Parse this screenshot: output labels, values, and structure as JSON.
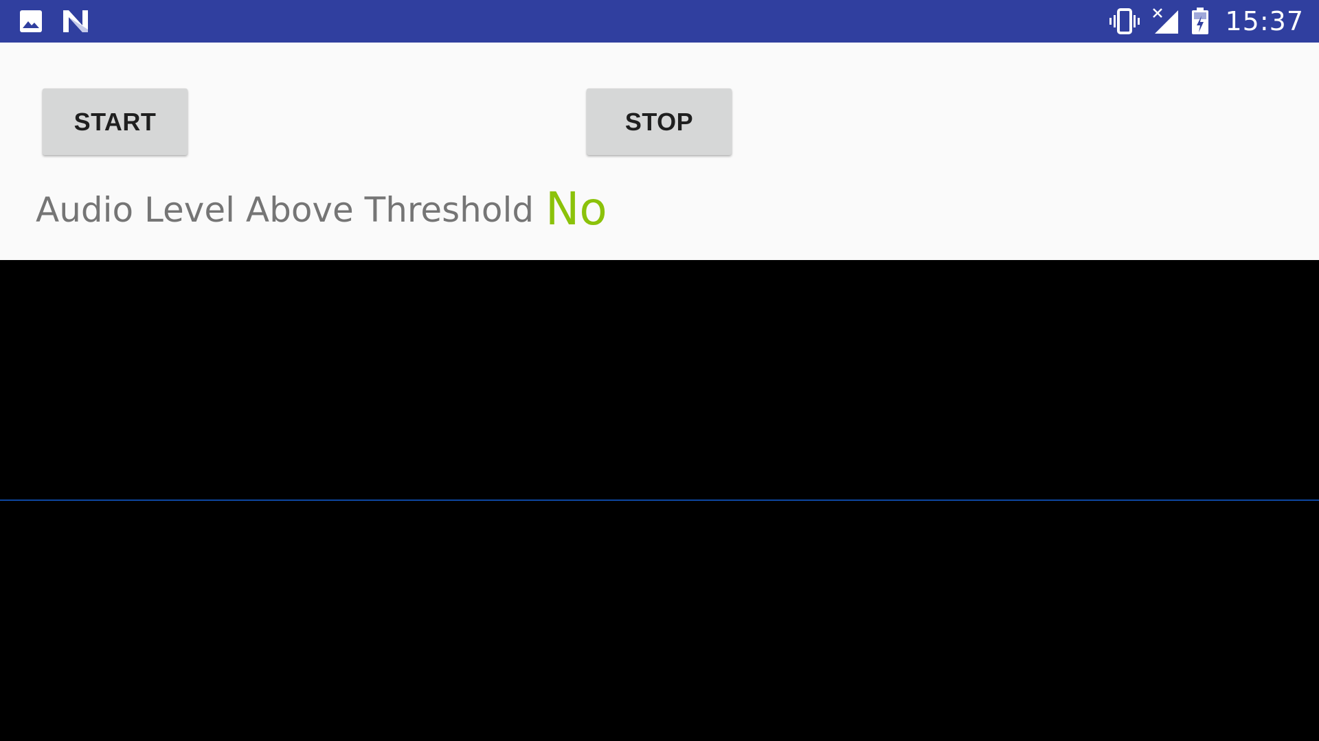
{
  "status_bar": {
    "time": "15:37",
    "background_color": "#303f9f",
    "left_icons": [
      "image-icon",
      "n-logo-icon"
    ],
    "right_icons": [
      "vibrate-icon",
      "no-signal-icon",
      "battery-charging-icon"
    ]
  },
  "controls": {
    "start_label": "START",
    "stop_label": "STOP"
  },
  "threshold": {
    "label": "Audio Level Above Threshold",
    "value": "No",
    "value_color": "#8bc20a"
  },
  "waveform": {
    "background_color": "#000000",
    "line_color": "#0d47a1",
    "level": 0
  }
}
